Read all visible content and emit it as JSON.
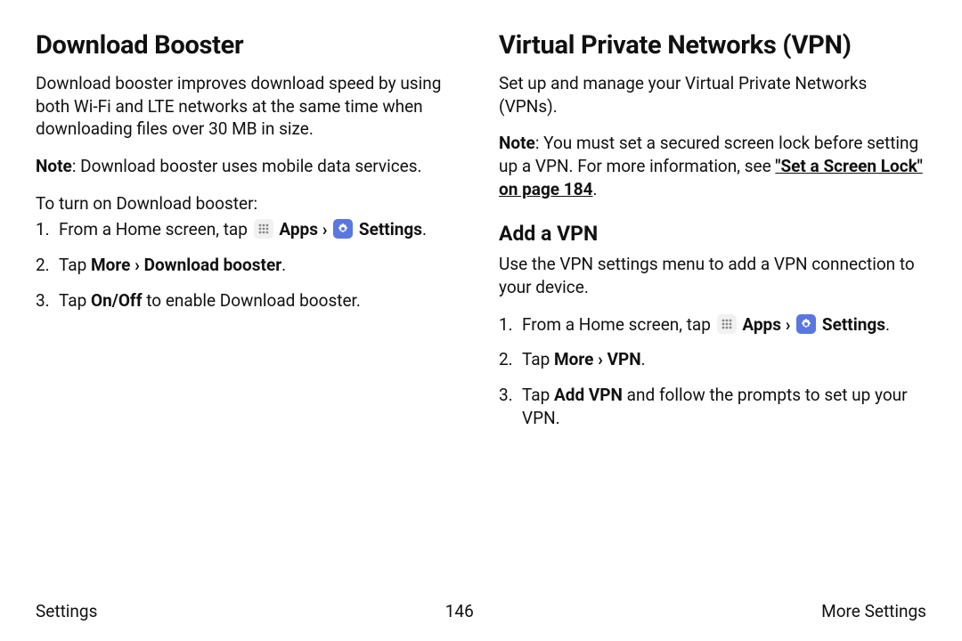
{
  "left": {
    "heading": "Download Booster",
    "intro": "Download booster improves download speed by using both Wi-Fi and LTE networks at the same time when downloading files over 30 MB in size.",
    "note_label": "Note",
    "note_text": ": Download booster uses mobile data services.",
    "lead": "To turn on Download booster:",
    "steps": {
      "s1_prefix": "From a Home screen, tap ",
      "s1_apps": "Apps",
      "s1_gt": " › ",
      "s1_settings": "Settings",
      "s1_suffix": ".",
      "s2_prefix": "Tap ",
      "s2_bold": "More › Download booster",
      "s2_suffix": ".",
      "s3_prefix": "Tap ",
      "s3_bold": "On/Off",
      "s3_suffix": " to enable Download booster."
    }
  },
  "right": {
    "heading": "Virtual Private Networks (VPN)",
    "intro": "Set up and manage your Virtual Private Networks (VPNs).",
    "note_label": "Note",
    "note_text_a": ": You must set a secured screen lock before setting up a VPN. For more information, see ",
    "note_link": "\"Set a Screen Lock\" on page 184",
    "note_text_b": ".",
    "sub": "Add a VPN",
    "sub_intro": "Use the VPN settings menu to add a VPN connection to your device.",
    "steps": {
      "s1_prefix": "From a Home screen, tap ",
      "s1_apps": "Apps",
      "s1_gt": " › ",
      "s1_settings": "Settings",
      "s1_suffix": ".",
      "s2_prefix": "Tap ",
      "s2_bold": "More › VPN",
      "s2_suffix": ".",
      "s3_prefix": "Tap ",
      "s3_bold": "Add VPN",
      "s3_suffix": " and follow the prompts to set up your VPN."
    }
  },
  "footer": {
    "left": "Settings",
    "center": "146",
    "right": "More Settings"
  },
  "nums": {
    "n1": "1.",
    "n2": "2.",
    "n3": "3."
  }
}
